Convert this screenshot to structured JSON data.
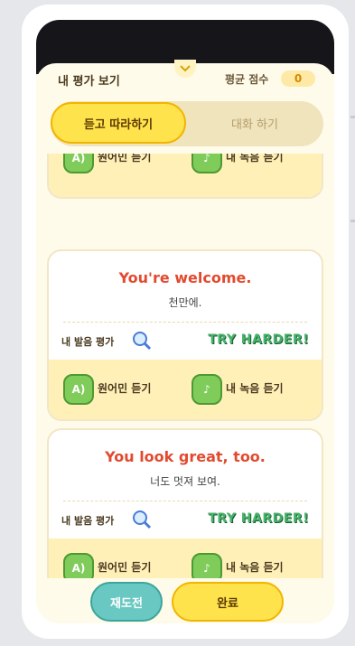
{
  "header": {
    "title": "내 평가 보기",
    "avg_label": "평균 점수",
    "avg_score": "0"
  },
  "tabs": [
    {
      "label": "듣고 따라하기",
      "active": true
    },
    {
      "label": "대화 하기",
      "active": false
    }
  ],
  "cards": [
    {
      "sentence": "",
      "translation": "",
      "eval_label": "",
      "rating": "",
      "native_label": "원어민 듣기",
      "mine_label": "내 녹음 듣기"
    },
    {
      "sentence": "You're welcome.",
      "translation": "천만에.",
      "eval_label": "내 발음 평가",
      "rating": "TRY HARDER!",
      "native_label": "원어민 듣기",
      "mine_label": "내 녹음 듣기"
    },
    {
      "sentence": "You look great, too.",
      "translation": "너도 멋져 보여.",
      "eval_label": "내 발음 평가",
      "rating": "TRY HARDER!",
      "native_label": "원어민 듣기",
      "mine_label": "내 녹음 듣기"
    }
  ],
  "footer": {
    "retry_label": "재도전",
    "done_label": "완료"
  },
  "colors": {
    "accent_yellow": "#ffe34d",
    "accent_teal": "#69c9c2",
    "sentence_red": "#e24a2f",
    "rating_green": "#47b26b"
  },
  "icons": [
    "chevron-down-icon",
    "speaker-a-icon",
    "recorder-icon",
    "magnifier-icon"
  ]
}
